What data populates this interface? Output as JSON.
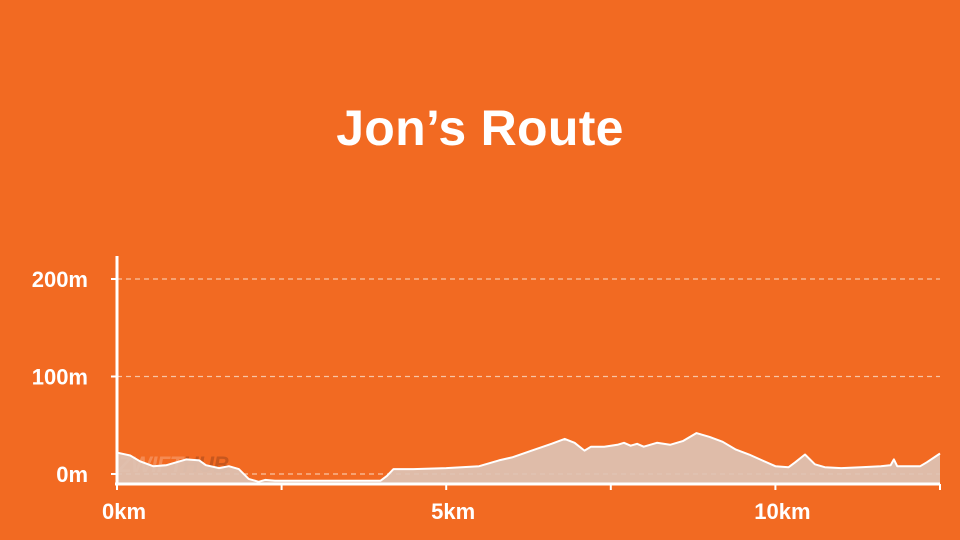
{
  "colors": {
    "background": "#F26A22",
    "text": "#FFFFFF",
    "axis": "#FFFFFF",
    "grid": "#F8C4A4",
    "area_fill": "#DDC3B5",
    "area_line": "#FFFFFF"
  },
  "watermark": {
    "part1": "ZWIFT",
    "part2": "HUB"
  },
  "chart_data": {
    "type": "area",
    "title": "Jon’s Route",
    "xlabel": "",
    "ylabel": "",
    "xlim": [
      0,
      12.5
    ],
    "ylim": [
      -10,
      225
    ],
    "grid": true,
    "legend": "none",
    "x_ticks": [
      {
        "value": 0,
        "label": "0km"
      },
      {
        "value": 5,
        "label": "5km"
      },
      {
        "value": 10,
        "label": "10km"
      }
    ],
    "x_minor_ticks": [
      2.5,
      7.5,
      12.5
    ],
    "y_ticks": [
      {
        "value": 0,
        "label": "0m"
      },
      {
        "value": 100,
        "label": "100m"
      },
      {
        "value": 200,
        "label": "200m"
      }
    ],
    "series": [
      {
        "x": [
          0,
          0.2,
          0.35,
          0.55,
          0.75,
          0.9,
          1.05,
          1.25,
          1.35,
          1.55,
          1.7,
          1.85,
          2.0,
          2.15,
          2.25,
          2.4,
          2.55,
          2.7,
          3.0,
          3.5,
          3.9,
          4.0,
          4.1,
          4.2,
          4.5,
          5.0,
          5.5,
          5.8,
          6.0,
          6.3,
          6.6,
          6.8,
          6.95,
          7.1,
          7.2,
          7.4,
          7.6,
          7.7,
          7.8,
          7.9,
          8.0,
          8.2,
          8.4,
          8.6,
          8.8,
          9.0,
          9.2,
          9.4,
          9.6,
          9.8,
          10.0,
          10.2,
          10.3,
          10.45,
          10.6,
          10.75,
          11.0,
          11.3,
          11.6,
          11.75,
          11.8,
          11.85,
          12.0,
          12.2,
          12.3,
          12.5
        ],
        "values": [
          22,
          19,
          13,
          8,
          9,
          12,
          15,
          14,
          9,
          6,
          8,
          5,
          -5,
          -8,
          -6,
          -7,
          -7,
          -7,
          -7,
          -7,
          -7,
          -7,
          -2,
          5,
          5,
          6,
          8,
          14,
          17,
          24,
          31,
          36,
          32,
          24,
          28,
          28,
          30,
          32,
          29,
          31,
          28,
          32,
          30,
          34,
          42,
          38,
          33,
          25,
          20,
          14,
          8,
          7,
          12,
          20,
          10,
          7,
          6,
          7,
          8,
          9,
          15,
          8,
          8,
          8,
          12,
          21
        ]
      }
    ]
  }
}
